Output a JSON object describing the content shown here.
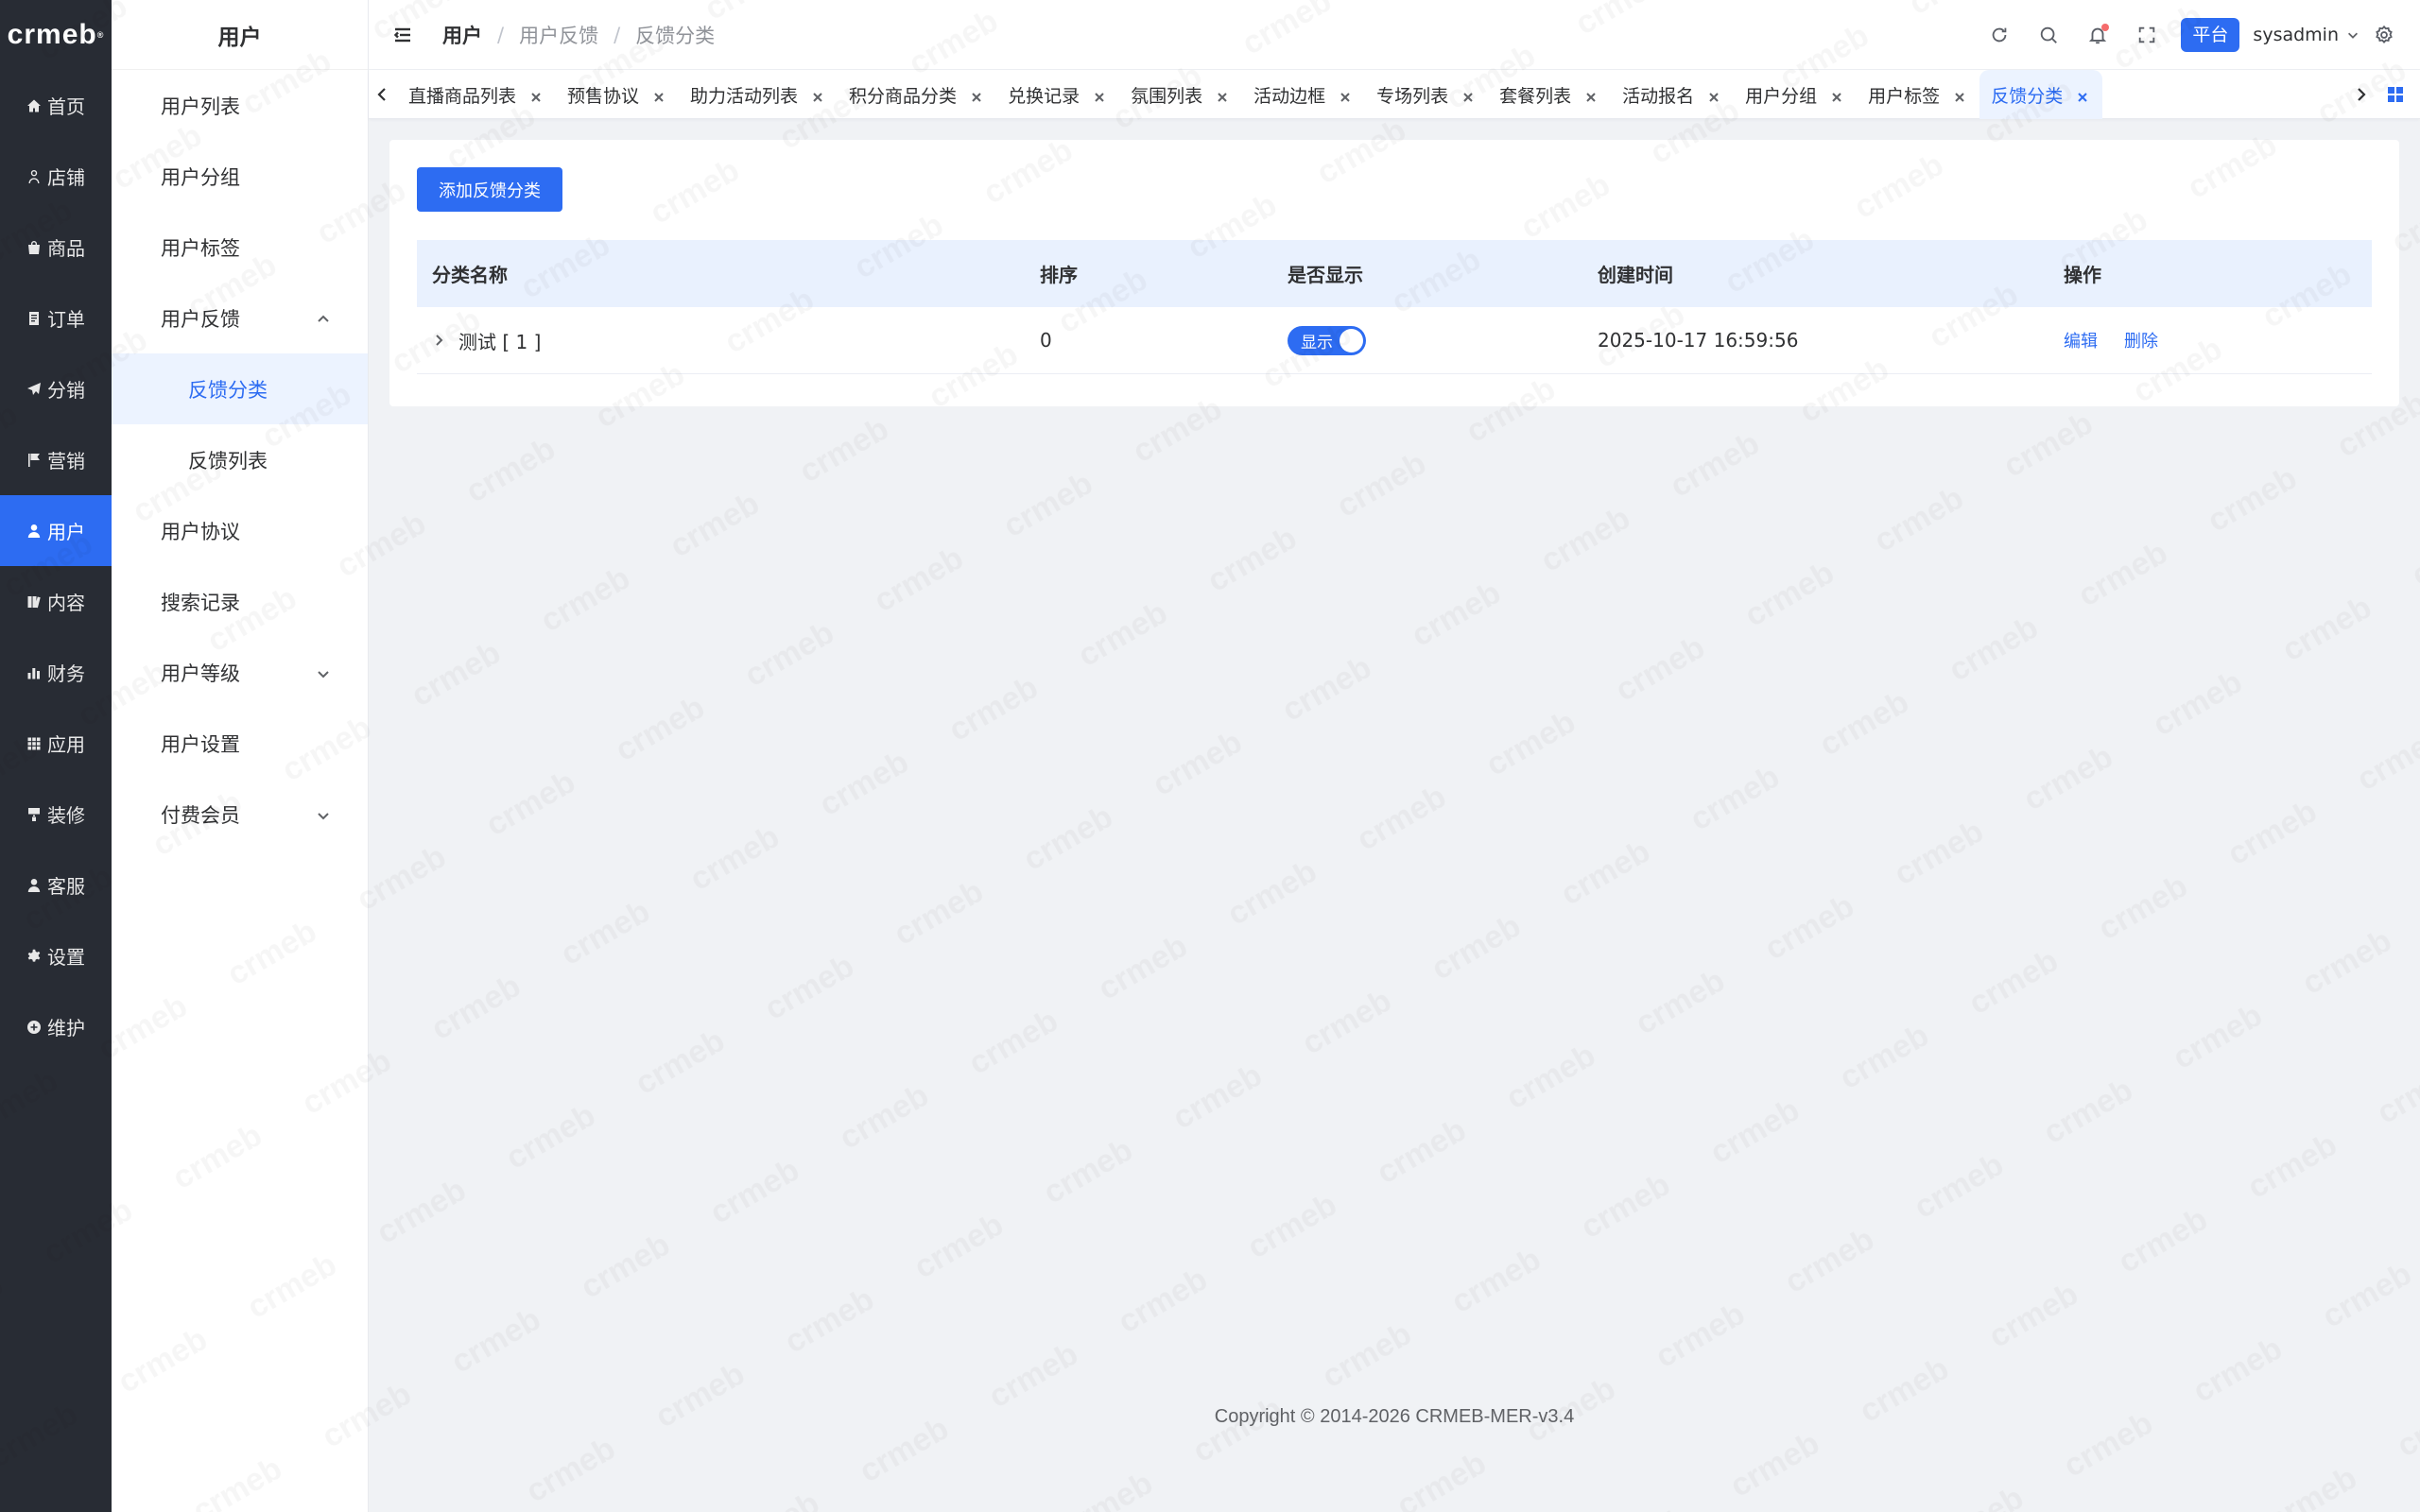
{
  "brand": {
    "logo": "crmeb",
    "logo_mark": "®"
  },
  "nav": {
    "items": [
      {
        "label": "首页",
        "icon": "home-icon"
      },
      {
        "label": "店铺",
        "icon": "shop-icon"
      },
      {
        "label": "商品",
        "icon": "goods-icon"
      },
      {
        "label": "订单",
        "icon": "order-icon"
      },
      {
        "label": "分销",
        "icon": "share-icon"
      },
      {
        "label": "营销",
        "icon": "flag-icon"
      },
      {
        "label": "用户",
        "icon": "user-icon",
        "active": true
      },
      {
        "label": "内容",
        "icon": "content-icon"
      },
      {
        "label": "财务",
        "icon": "finance-icon"
      },
      {
        "label": "应用",
        "icon": "apps-icon"
      },
      {
        "label": "装修",
        "icon": "decorate-icon"
      },
      {
        "label": "客服",
        "icon": "service-icon"
      },
      {
        "label": "设置",
        "icon": "gear-icon"
      },
      {
        "label": "维护",
        "icon": "maintain-icon"
      }
    ]
  },
  "submenu": {
    "title": "用户",
    "items": [
      {
        "label": "用户列表"
      },
      {
        "label": "用户分组"
      },
      {
        "label": "用户标签"
      },
      {
        "label": "用户反馈",
        "expanded": true
      },
      {
        "label": "反馈分类",
        "child": true,
        "active": true
      },
      {
        "label": "反馈列表",
        "child": true
      },
      {
        "label": "用户协议"
      },
      {
        "label": "搜索记录"
      },
      {
        "label": "用户等级",
        "collapsible": true
      },
      {
        "label": "用户设置"
      },
      {
        "label": "付费会员",
        "collapsible": true
      }
    ]
  },
  "header": {
    "breadcrumb": [
      "用户",
      "用户反馈",
      "反馈分类"
    ],
    "separator": "/",
    "platform_badge": "平台",
    "username": "sysadmin"
  },
  "tabs": [
    {
      "label": "直播商品列表"
    },
    {
      "label": "预售协议"
    },
    {
      "label": "助力活动列表"
    },
    {
      "label": "积分商品分类"
    },
    {
      "label": "兑换记录"
    },
    {
      "label": "氛围列表"
    },
    {
      "label": "活动边框"
    },
    {
      "label": "专场列表"
    },
    {
      "label": "套餐列表"
    },
    {
      "label": "活动报名"
    },
    {
      "label": "用户分组"
    },
    {
      "label": "用户标签"
    },
    {
      "label": "反馈分类",
      "active": true
    }
  ],
  "main": {
    "add_button": "添加反馈分类",
    "columns": [
      "分类名称",
      "排序",
      "是否显示",
      "创建时间",
      "操作"
    ],
    "rows": [
      {
        "name": "测试 [ 1 ]",
        "sort": "0",
        "show_label": "显示",
        "show_on": true,
        "created": "2025-10-17 16:59:56",
        "actions": [
          "编辑",
          "删除"
        ]
      }
    ]
  },
  "footer": {
    "copyright": "Copyright © 2014-2026 CRMEB-MER-v3.4"
  },
  "colors": {
    "primary": "#2d6cf2",
    "nav_bg": "#282c34",
    "page_bg": "#f0f2f5",
    "table_head_bg": "#e9f1fe"
  }
}
